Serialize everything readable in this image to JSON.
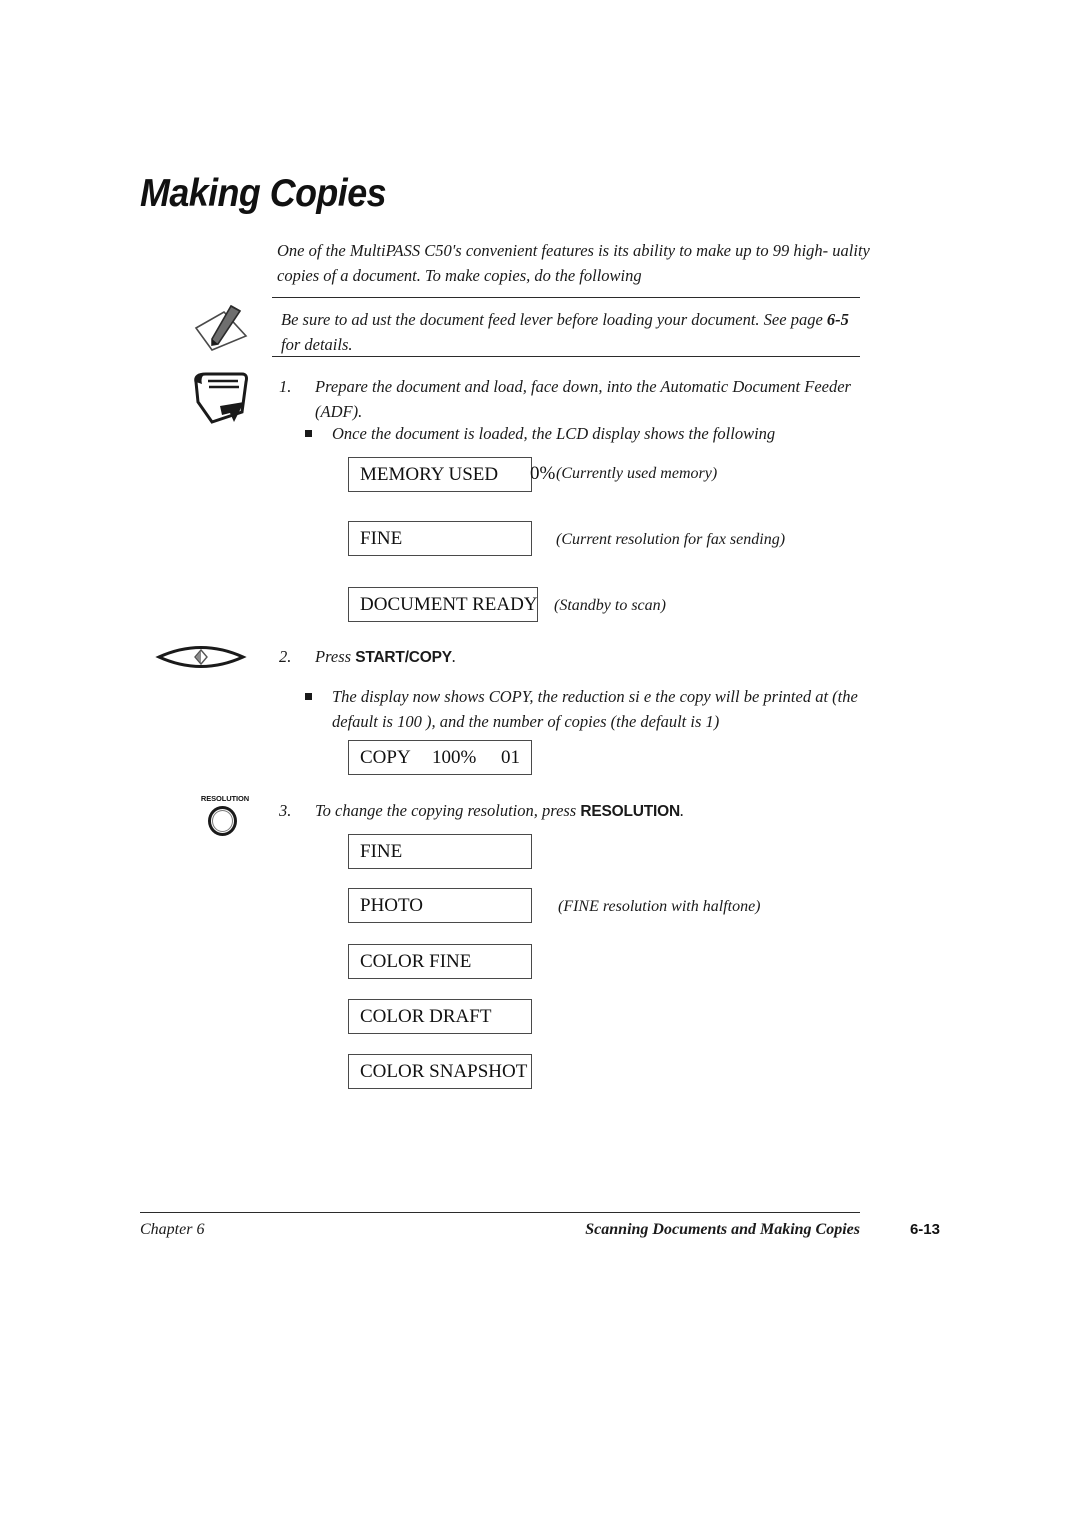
{
  "page": {
    "title": "Making Copies",
    "intro": "One of the MultiPASS C50's convenient features is its ability to make up to 99 high-  uality copies of a document. To make copies, do the following"
  },
  "note": {
    "icon": "pencil-note-icon",
    "text_line1": "Be sure to ad ust the document feed lever before loading your document. See",
    "text_line2_prefix": "page ",
    "text_line2_ref": "6-5",
    "text_line2_suffix": " for details."
  },
  "steps": [
    {
      "number": "1.",
      "icon": "document-stack-icon",
      "text": "Prepare the document and load, face down, into the Automatic Document Feeder (ADF)."
    },
    {
      "number": "2.",
      "icon": "start-copy-key-icon",
      "prefix": "Press ",
      "key": "START/COPY",
      "suffix": "."
    },
    {
      "number": "3.",
      "icon": "resolution-key-icon",
      "icon_label": "RESOLUTION",
      "prefix": "To change the copying resolution, press  ",
      "key": "RESOLUTION",
      "suffix": "."
    }
  ],
  "bullets": [
    {
      "text": "Once the document is loaded, the LCD display shows the following"
    },
    {
      "text": "The display now shows COPY, the reduction si  e the copy will be printed at (the default is 100   ), and the number of copies (the default is 1)"
    }
  ],
  "lcd_displays": [
    {
      "name": "memory-used",
      "main": "MEMORY USED",
      "value": "0%",
      "caption": "(Currently used memory)"
    },
    {
      "name": "fine-resolution",
      "main": "FINE",
      "caption": "(Current resolution for fax sending)"
    },
    {
      "name": "document-ready",
      "main": "DOCUMENT READY",
      "caption": "(Standby to scan)"
    },
    {
      "name": "copy-status",
      "main": "COPY",
      "mid": "100%",
      "right": "01"
    }
  ],
  "resolution_options": [
    {
      "name": "fine",
      "main": "FINE"
    },
    {
      "name": "photo",
      "main": "PHOTO",
      "caption": "(FINE resolution with halftone)"
    },
    {
      "name": "color-fine",
      "main": "COLOR FINE"
    },
    {
      "name": "color-draft",
      "main": "COLOR DRAFT"
    },
    {
      "name": "color-snapshot",
      "main": "COLOR SNAPSHOT"
    }
  ],
  "footer": {
    "left": "Chapter 6",
    "center": "Scanning Documents and Making Copies",
    "page_number": "6-13"
  }
}
